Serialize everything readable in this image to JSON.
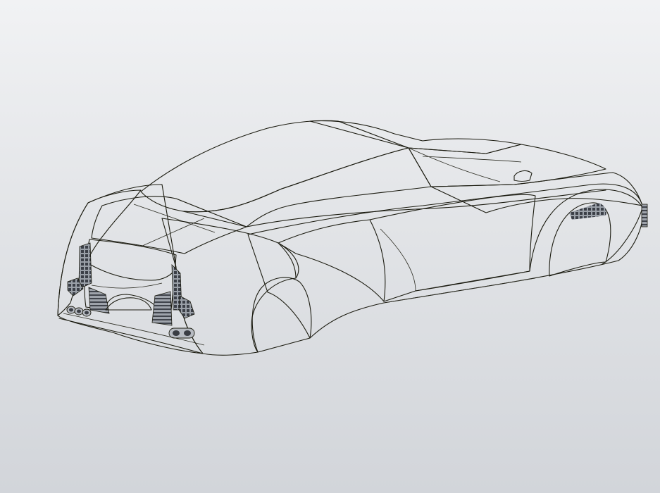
{
  "viewport": {
    "background_top": "#f1f2f4",
    "background_bottom": "#d2d5da"
  },
  "model": {
    "body_color": "#9a9c00",
    "body_shadow_color": "#6f7000",
    "glass_color": "#6d7384",
    "glass_dark_color": "#4b505d",
    "edge_color": "#1b1b10",
    "grille_color": "#8a8f98"
  }
}
